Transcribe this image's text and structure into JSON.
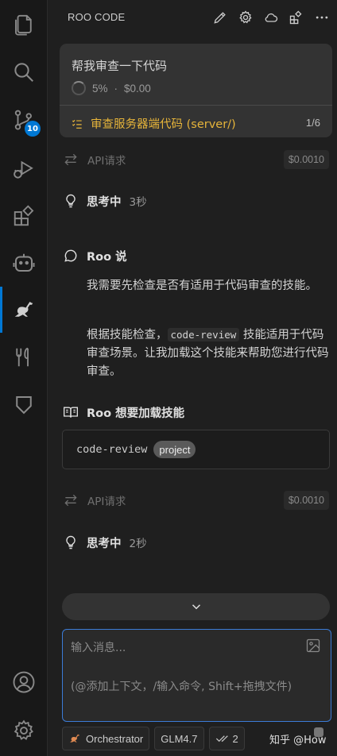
{
  "activity_bar": {
    "items": [
      {
        "icon": "files-icon"
      },
      {
        "icon": "search-icon"
      },
      {
        "icon": "source-control-icon",
        "badge": "10"
      },
      {
        "icon": "run-debug-icon"
      },
      {
        "icon": "extensions-icon"
      },
      {
        "icon": "robot-icon"
      },
      {
        "icon": "kangaroo-icon",
        "active": true
      },
      {
        "icon": "utensils-icon"
      },
      {
        "icon": "shield-icon"
      },
      {
        "icon": "account-icon"
      },
      {
        "icon": "settings-gear-icon"
      }
    ],
    "source_control_badge": "10"
  },
  "header": {
    "title": "ROO CODE",
    "icons": [
      "pencil-icon",
      "gear-icon",
      "cloud-icon",
      "marketplace-icon",
      "more-icon"
    ]
  },
  "task": {
    "title": "帮我审查一下代码",
    "progress": "5%",
    "separator": "·",
    "cost": "$0.00",
    "subtask_label": "审查服务器端代码 (server/)",
    "subtask_count": "1/6"
  },
  "chat": {
    "api_label": "API请求",
    "api1_cost": "$0.0010",
    "thinking_label": "思考中",
    "thinking1_time": "3秒",
    "roo_says": "Roo 说",
    "para1": "我需要先检查是否有适用于代码审查的技能。",
    "para2_before": "根据技能检查，",
    "para2_code": "code-review",
    "para2_after": " 技能适用于代码审查场景。让我加载这个技能来帮助您进行代码审查。",
    "load_skill_label": "Roo 想要加载技能",
    "skill_name": "code-review",
    "skill_tag": "project",
    "api2_cost": "$0.0010",
    "thinking2_time": "2秒"
  },
  "input": {
    "placeholder": "输入消息...",
    "hint": "(@添加上下文，/输入命令, Shift+拖拽文件)"
  },
  "bottom_bar": {
    "mode": "Orchestrator",
    "model": "GLM4.7",
    "approve_count": "2",
    "watermark": "知乎 @How"
  },
  "colors": {
    "accent": "#0078d4",
    "subtask": "#e6b43a",
    "input_border": "#3b7bd6"
  }
}
